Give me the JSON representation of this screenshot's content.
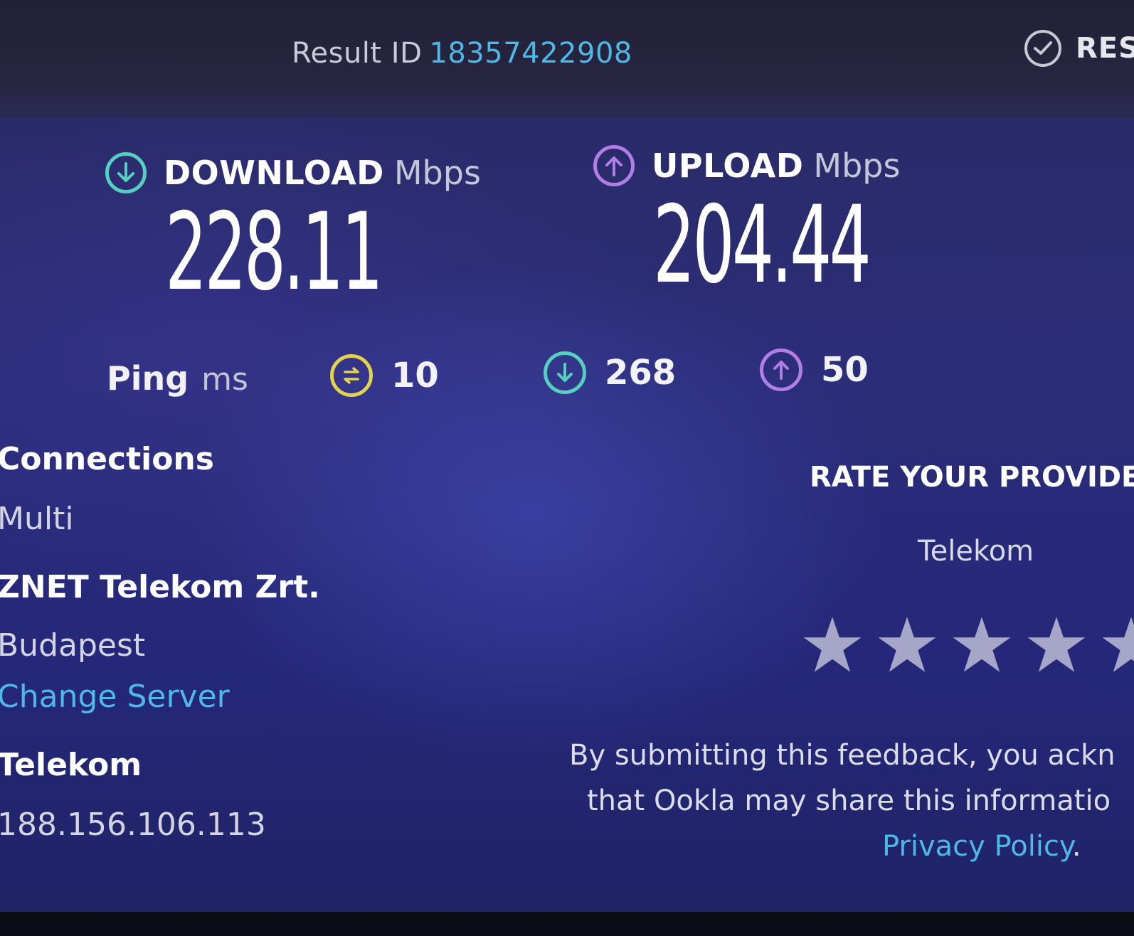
{
  "header": {
    "result_id_label": "Result ID",
    "result_id_value": "18357422908",
    "results_button_label": "RES",
    "results_icon": "check-circle-icon"
  },
  "download": {
    "title": "DOWNLOAD",
    "unit": "Mbps",
    "value": "228.11",
    "icon": "download-arrow-icon",
    "color": "#55d0c0"
  },
  "upload": {
    "title": "UPLOAD",
    "unit": "Mbps",
    "value": "204.44",
    "icon": "upload-arrow-icon",
    "color": "#b07ee6"
  },
  "ping": {
    "label": "Ping",
    "unit": "ms",
    "idle": {
      "value": "10",
      "icon": "idle-latency-icon",
      "color": "#e2d34a"
    },
    "download": {
      "value": "268",
      "icon": "download-latency-icon",
      "color": "#55d0c0"
    },
    "upload": {
      "value": "50",
      "icon": "upload-latency-icon",
      "color": "#b07ee6"
    }
  },
  "connection": {
    "title": "Connections",
    "mode": "Multi",
    "server_name": "ZNET Telekom Zrt.",
    "server_city": "Budapest",
    "change_server_label": "Change Server",
    "isp_name": "Telekom",
    "ip_address": "188.156.106.113"
  },
  "rating": {
    "title": "RATE YOUR PROVIDE",
    "provider": "Telekom",
    "star_count_visible": 5,
    "star_color": "#a6a6c8",
    "disclaimer_line1": "By submitting this feedback, you ackn",
    "disclaimer_line2": "that Ookla may share this informatio",
    "privacy_link": "Privacy Policy",
    "privacy_suffix": "."
  },
  "colors": {
    "accent_link": "#4fb8e6",
    "background": "#2b2d78",
    "topbar": "#232137"
  }
}
